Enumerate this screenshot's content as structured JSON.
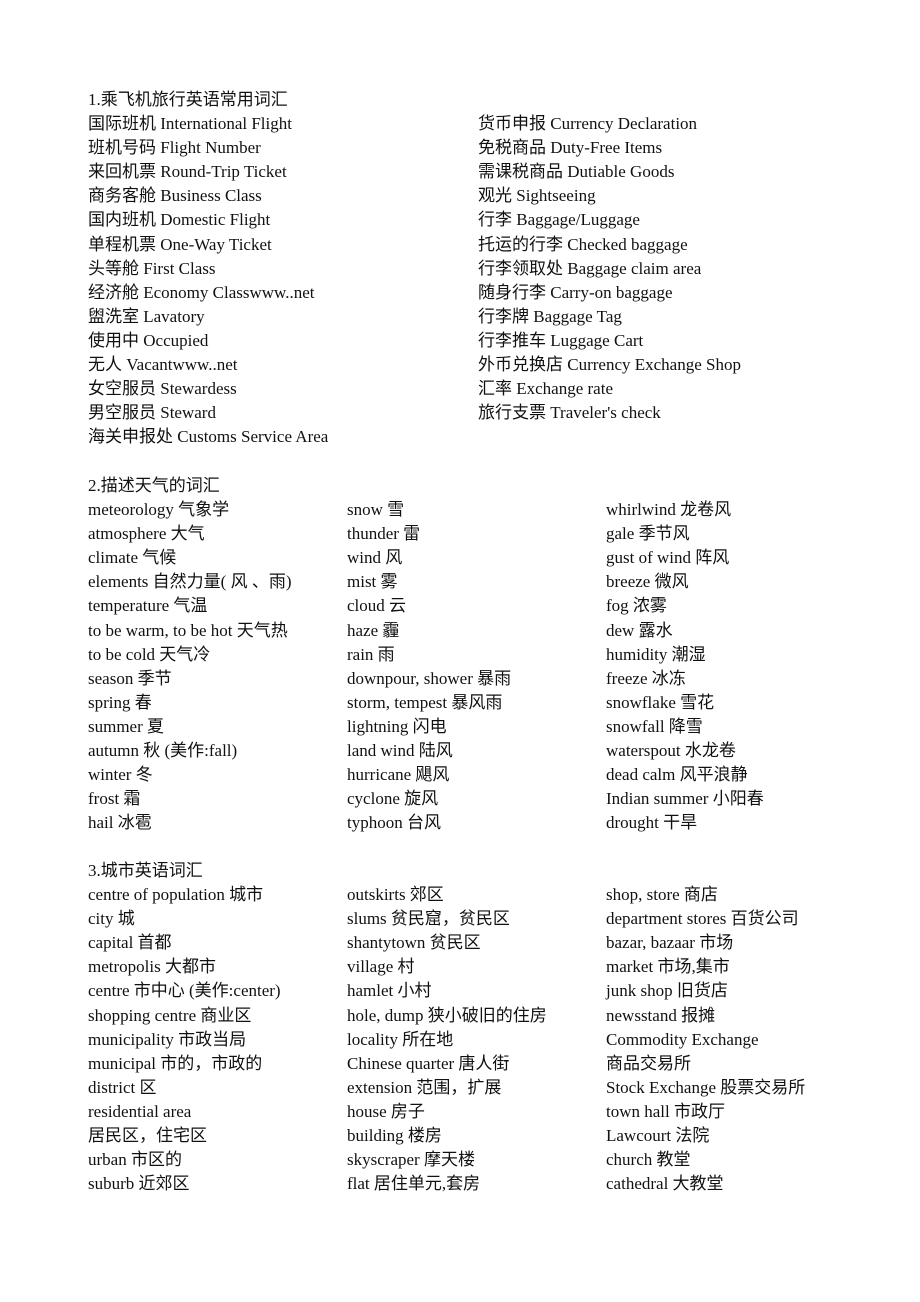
{
  "sections": [
    {
      "title": "1.乘飞机旅行英语常用词汇",
      "columns": [
        [
          "国际班机  International Flight",
          "班机号码  Flight Number",
          "来回机票  Round-Trip Ticket",
          "商务客舱  Business Class",
          "国内班机  Domestic Flight",
          "单程机票  One-Way Ticket",
          "头等舱  First Class",
          "经济舱  Economy Classwww..net",
          "盥洗室  Lavatory",
          "使用中  Occupied",
          "无人  Vacantwww..net",
          "女空服员  Stewardess",
          "男空服员  Steward",
          "海关申报处  Customs Service Area"
        ],
        [
          "货币申报  Currency Declaration",
          "免税商品  Duty-Free Items",
          "需课税商品  Dutiable Goods",
          "观光  Sightseeing",
          "行李  Baggage/Luggage",
          "托运的行李  Checked baggage",
          "行李领取处  Baggage claim area",
          "随身行李  Carry-on baggage",
          "行李牌  Baggage Tag",
          "行李推车 Luggage Cart",
          "外币兑换店  Currency Exchange Shop",
          "汇率  Exchange rate",
          "旅行支票  Traveler's check"
        ]
      ]
    },
    {
      "title": "2.描述天气的词汇",
      "columns": [
        [
          "meteorology  气象学",
          "atmosphere  大气",
          "climate  气候",
          "elements  自然力量( 风  、雨)",
          "temperature  气温",
          "to be warm, to be hot  天气热",
          "to be cold  天气冷",
          "season  季节",
          "spring  春",
          "summer  夏",
          "autumn  秋  (美作:fall)",
          "winter  冬",
          "frost  霜",
          "hail  冰雹"
        ],
        [
          "snow  雪",
          "thunder  雷",
          "wind  风",
          "mist  雾",
          "cloud  云",
          "haze  霾",
          "rain  雨",
          "downpour, shower  暴雨",
          "storm, tempest  暴风雨",
          "lightning  闪电",
          "land wind  陆风",
          "hurricane  飓风",
          "cyclone  旋风",
          "typhoon  台风"
        ],
        [
          "whirlwind  龙卷风",
          "gale  季节风",
          "gust of wind  阵风",
          "breeze  微风",
          "fog  浓雾",
          "dew  露水",
          "humidity  潮湿",
          "freeze  冰冻",
          "snowflake  雪花",
          "snowfall  降雪",
          "waterspout  水龙卷",
          "dead calm  风平浪静",
          "Indian summer  小阳春",
          "drought  干旱"
        ]
      ]
    },
    {
      "title": "3.城市英语词汇",
      "columns": [
        [
          "centre of population  城市",
          "city  城",
          "capital  首都",
          "metropolis  大都市",
          "centre  市中心  (美作:center)",
          "shopping centre  商业区",
          "municipality  市政当局",
          "municipal  市的，市政的",
          "district  区",
          "residential area",
          "居民区，住宅区",
          "urban  市区的",
          "suburb  近郊区"
        ],
        [
          "outskirts  郊区",
          "slums  贫民窟，贫民区",
          "shantytown  贫民区",
          "village  村",
          "hamlet  小村",
          "hole, dump  狭小破旧的住房",
          "locality  所在地",
          "Chinese quarter  唐人街",
          "extension  范围，扩展",
          "house  房子",
          "building  楼房",
          "skyscraper  摩天楼",
          "flat  居住单元,套房"
        ],
        [
          "shop, store  商店",
          "department stores  百货公司",
          "bazar, bazaar  市场",
          "market  市场,集市",
          "junk shop  旧货店",
          "newsstand  报摊",
          "Commodity Exchange",
          "商品交易所",
          "Stock Exchange  股票交易所",
          "town hall  市政厅",
          "Lawcourt  法院",
          "church  教堂",
          "cathedral  大教堂"
        ]
      ]
    }
  ]
}
